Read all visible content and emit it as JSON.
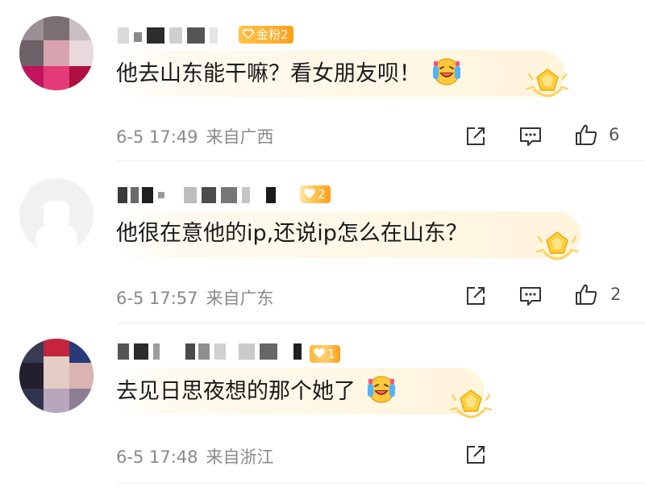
{
  "comments": [
    {
      "badge": "金粉2",
      "text": "他去山东能干嘛？看女朋友呗！",
      "time": "6-5 17:49",
      "location": "来自广西",
      "likes": "6"
    },
    {
      "badge": "2",
      "text": "他很在意他的ip,还说ip怎么在山东？",
      "time": "6-5 17:57",
      "location": "来自广东",
      "likes": "2"
    },
    {
      "badge": "1",
      "text": "去见日思夜想的那个她了",
      "time": "6-5 17:48",
      "location": "来自浙江"
    }
  ],
  "icons": {
    "share": "share-icon",
    "comment": "comment-icon",
    "like": "thumbs-up-icon",
    "fan_badge": "heart-badge-icon",
    "crown": "star-crown-icon",
    "emoji": "laughing-crying-emoji"
  },
  "colors": {
    "badge": "#ffb02e",
    "meta_text": "#8a8a8a",
    "bubble": "#fff4dc"
  }
}
